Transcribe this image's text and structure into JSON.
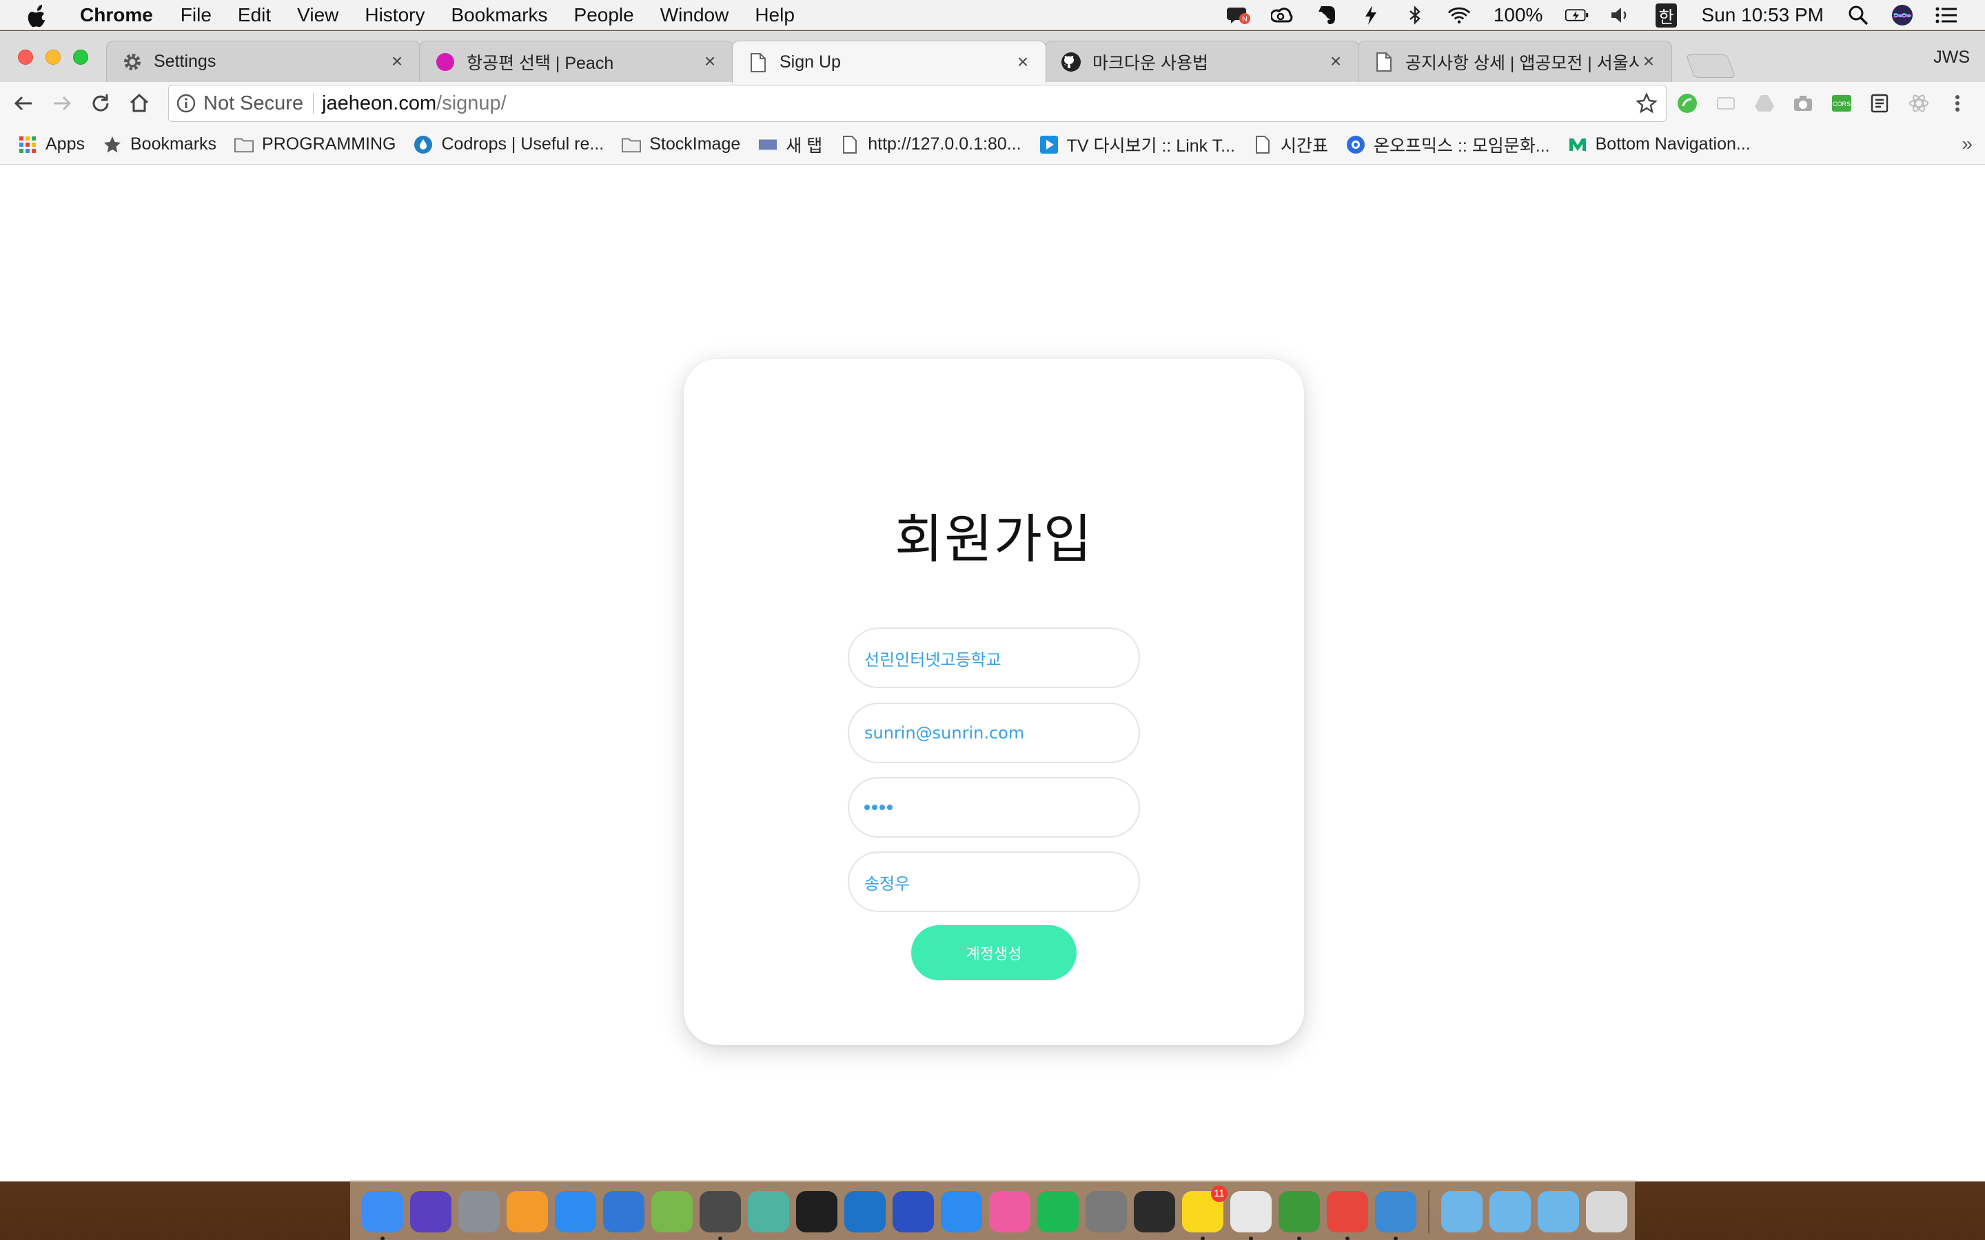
{
  "menubar": {
    "app_name": "Chrome",
    "menus": [
      "File",
      "Edit",
      "View",
      "History",
      "Bookmarks",
      "People",
      "Window",
      "Help"
    ],
    "battery": "100%",
    "input_source": "한",
    "clock": "Sun 10:53 PM",
    "status_icons": [
      "notification-n-icon",
      "creative-cloud-icon",
      "evernote-icon",
      "flash-icon",
      "bluetooth-icon",
      "wifi-icon",
      "battery-icon",
      "volume-icon",
      "spotlight-icon",
      "siri-icon",
      "notification-center-icon"
    ]
  },
  "tabs": [
    {
      "title": "Settings",
      "icon": "gear-icon",
      "active": false
    },
    {
      "title": "항공편 선택 | Peach",
      "icon": "peach-icon",
      "active": false
    },
    {
      "title": "Sign Up",
      "icon": "page-icon",
      "active": true
    },
    {
      "title": "마크다운 사용법",
      "icon": "github-icon",
      "active": false
    },
    {
      "title": "공지사항 상세 | 앱공모전 | 서울시 도",
      "icon": "page-icon",
      "active": false
    }
  ],
  "profile_name": "JWS",
  "omnibox": {
    "security_label": "Not Secure",
    "host": "jaeheon.com",
    "path": "/signup/"
  },
  "bookmarks": [
    {
      "label": "Apps",
      "icon": "apps-grid-icon"
    },
    {
      "label": "Bookmarks",
      "icon": "star-icon"
    },
    {
      "label": "PROGRAMMING",
      "icon": "folder-icon"
    },
    {
      "label": "Codrops | Useful re...",
      "icon": "codrops-icon"
    },
    {
      "label": "StockImage",
      "icon": "folder-icon"
    },
    {
      "label": "새 탭",
      "icon": "newtab-icon"
    },
    {
      "label": "http://127.0.0.1:80...",
      "icon": "page-icon"
    },
    {
      "label": "TV 다시보기 :: Link T...",
      "icon": "play-icon"
    },
    {
      "label": "시간표",
      "icon": "page-icon"
    },
    {
      "label": "온오프믹스 :: 모임문화...",
      "icon": "onoffmix-icon"
    },
    {
      "label": "Bottom Navigation...",
      "icon": "medium-icon"
    }
  ],
  "signup": {
    "title": "회원가입",
    "school_value": "선린인터넷고등학교",
    "email_value": "sunrin@sunrin.com",
    "password_length": 4,
    "name_value": "송정우",
    "submit_label": "계정생성"
  },
  "colors": {
    "accent_button": "#3eecb1",
    "input_text": "#3aa0e8",
    "title_text": "#111111"
  },
  "dock": {
    "apps": [
      {
        "name": "finder",
        "color": "#3d8ef5",
        "running": true
      },
      {
        "name": "siri",
        "color": "#5a3fc0",
        "running": false
      },
      {
        "name": "launchpad",
        "color": "#8a8f98",
        "running": false
      },
      {
        "name": "ibooks",
        "color": "#f39a2b",
        "running": false
      },
      {
        "name": "app-store",
        "color": "#2d8cf0",
        "running": false
      },
      {
        "name": "xcode",
        "color": "#3178d6",
        "running": false
      },
      {
        "name": "android-studio",
        "color": "#79b84a",
        "running": false
      },
      {
        "name": "sublime-text",
        "color": "#4a4a4a",
        "running": true
      },
      {
        "name": "atom",
        "color": "#4fb3a1",
        "running": false
      },
      {
        "name": "pycharm",
        "color": "#1f1f1f",
        "running": false
      },
      {
        "name": "webstorm",
        "color": "#1c73c8",
        "running": false
      },
      {
        "name": "firefox",
        "color": "#2c4fc4",
        "running": false
      },
      {
        "name": "safari",
        "color": "#2d8cf0",
        "running": false
      },
      {
        "name": "itunes",
        "color": "#f05aa0",
        "running": false
      },
      {
        "name": "spotify",
        "color": "#1db954",
        "running": false
      },
      {
        "name": "system-preferences",
        "color": "#7a7a7a",
        "running": false
      },
      {
        "name": "terminal",
        "color": "#2b2b2b",
        "running": false
      },
      {
        "name": "kakaotalk",
        "color": "#f9d71c",
        "running": true,
        "badge": "11"
      },
      {
        "name": "slack",
        "color": "#e8e8e8",
        "running": true
      },
      {
        "name": "evernote",
        "color": "#3c9a3a",
        "running": true
      },
      {
        "name": "chrome",
        "color": "#e8453c",
        "running": true
      },
      {
        "name": "tweetbot",
        "color": "#3a8ad6",
        "running": true
      }
    ],
    "folders": [
      {
        "name": "downloads-folder",
        "color": "#6cb6ea"
      },
      {
        "name": "applications-folder",
        "color": "#6cb6ea"
      },
      {
        "name": "drive-folder",
        "color": "#6cb6ea"
      },
      {
        "name": "trash",
        "color": "#d9d9d9"
      }
    ]
  }
}
